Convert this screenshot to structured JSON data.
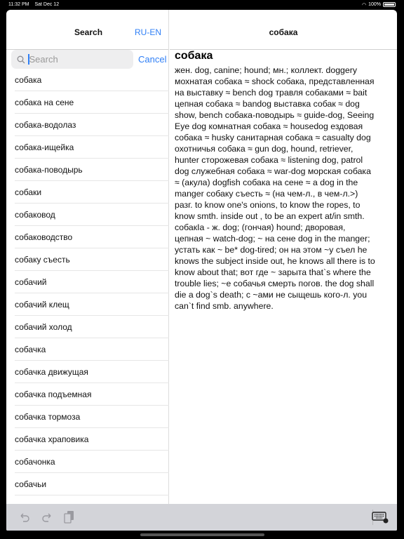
{
  "status": {
    "time": "11:32 PM",
    "date": "Sat Dec 12",
    "battery": "100%",
    "battery_level": 100
  },
  "left": {
    "title": "Search",
    "lang_button": "RU-EN",
    "search_placeholder": "Search",
    "cancel": "Cancel",
    "results": [
      "собака",
      "собака на сене",
      "собака-водолаз",
      "собака-ищейка",
      "собака-поводырь",
      "собаки",
      "собаковод",
      "собаководство",
      "собаку съесть",
      "собачий",
      "собачий клещ",
      "собачий холод",
      "собачка",
      "собачка движущая",
      "собачка подъемная",
      "собачка тормоза",
      "собачка храповика",
      "собачонка",
      "собачьи"
    ]
  },
  "right": {
    "title": "собака",
    "headword": "собака",
    "definition_lines": [
      "жен. dog, canine; hound; мн.; коллект. doggery",
      "мохнатая собака ≈ shock собака, представленная",
      "на выставку ≈ bench dog травля собаками ≈ bait",
      "цепная собака ≈ bandog выставка собак ≈ dog",
      "show, bench собака-поводырь ≈ guide-dog, Seeing",
      "Eye dog комнатная собака ≈ housedog ездовая",
      "собака ≈ husky санитарная собака ≈ casualty dog",
      "охотничья собака ≈ gun dog, hound, retriever,",
      "hunter сторожевая собака ≈ listening dog, patrol",
      "dog служебная собака ≈ war-dog морская собака",
      "≈ (акула) dogfish собака на сене ≈ a dog in the",
      "manger собаку съесть ≈ (на чем-л., в чем-л.>)",
      "разг. to know one's onions, to know the ropes, to",
      "know smth. inside out , to be an expert at/in smth.",
      "собакIa - ж. dog; (гончая) hound; дворовая,",
      "цепная ~ watch-dog; ~ на сене dog in the manger;",
      "устать как ~ be* dog-tired; он на этом ~у съел he",
      "knows the subject inside out, he knows all there is to",
      "know about that; вот где ~ зарыта that`s where the",
      "trouble lies; ~e собачья смерть погов. the dog shall",
      "die a dog`s death; с ~ами не сыщешь кого-л. you",
      "can`t find smb. anywhere."
    ]
  },
  "toolbar": {
    "icons": [
      "undo-icon",
      "redo-icon",
      "paste-icon",
      "keyboard-dismiss-icon"
    ]
  },
  "colors": {
    "accent": "#2f7ff6",
    "toolbar": "#d3d4d9"
  }
}
